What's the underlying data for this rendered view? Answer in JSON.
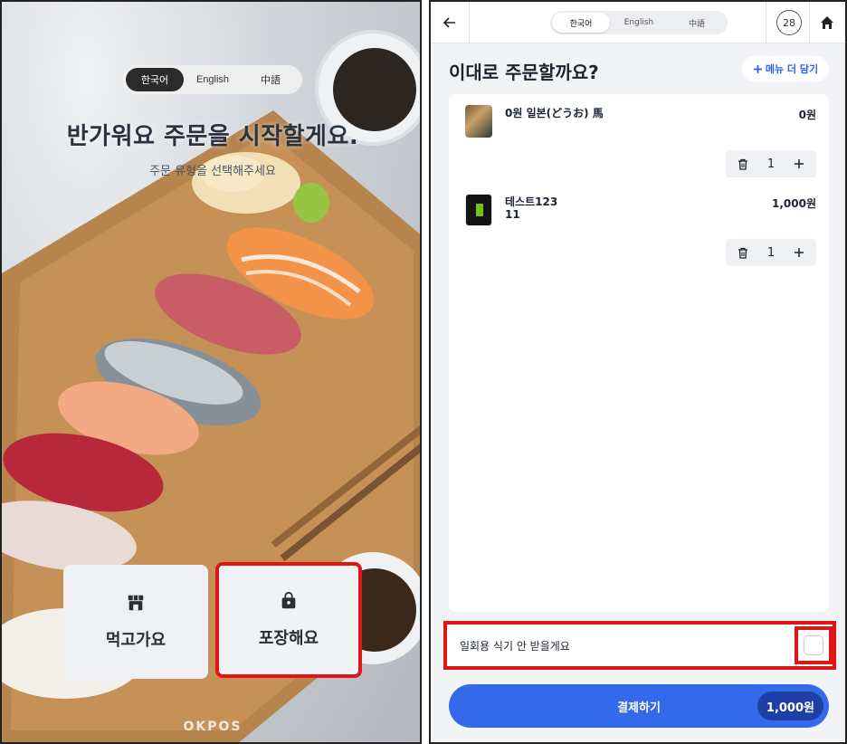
{
  "left": {
    "languages": [
      "한국어",
      "English",
      "中語"
    ],
    "active_language": "한국어",
    "welcome_title": "반가워요 주문을 시작할게요.",
    "welcome_subtitle": "주문 유형을 선택해주세요",
    "eat_in_label": "먹고가요",
    "takeout_label": "포장해요",
    "brand": "OKPOS",
    "eat_in_icon": "store-icon",
    "takeout_icon": "shopping-bag-icon"
  },
  "right": {
    "languages": [
      "한국어",
      "English",
      "中語"
    ],
    "active_language": "한국어",
    "timer": "28",
    "title": "이대로 주문할까요?",
    "add_more_label": "메뉴 더 담기",
    "items": [
      {
        "name": "0원 일본(どうお) 馬",
        "price": "0원",
        "qty": "1",
        "thumb": "sushi"
      },
      {
        "name_line1": "테스트123",
        "name_line2": "11",
        "price": "1,000원",
        "qty": "1",
        "thumb": "can"
      }
    ],
    "disposable_label": "일회용 식기 안 받을게요",
    "disposable_checked": false,
    "pay_label": "결제하기",
    "pay_total": "1,000원",
    "accent_color": "#3469ec",
    "highlight_color": "#e01616"
  }
}
